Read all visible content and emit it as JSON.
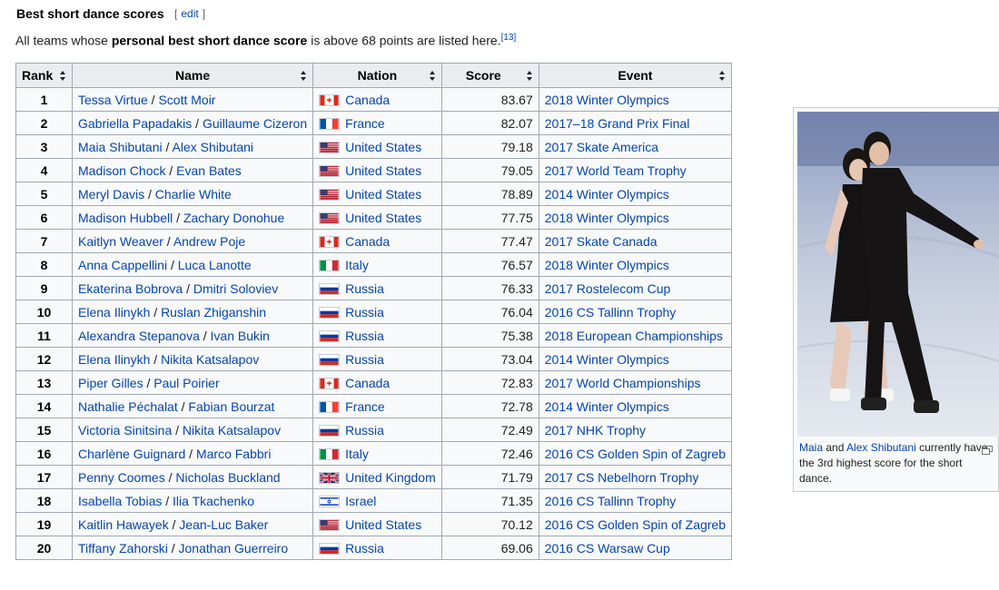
{
  "section": {
    "heading": "Best short dance scores",
    "edit_link": "edit",
    "intro_pre": "All teams whose ",
    "intro_bold": "personal best short dance score",
    "intro_post": " is above 68 points are listed here.",
    "ref": "[13]"
  },
  "table": {
    "headers": [
      "Rank",
      "Name",
      "Nation",
      "Score",
      "Event"
    ],
    "rows": [
      {
        "rank": "1",
        "p1": "Tessa Virtue",
        "p2": "Scott Moir",
        "nation": "Canada",
        "flag": "ca",
        "score": "83.67",
        "event": "2018 Winter Olympics"
      },
      {
        "rank": "2",
        "p1": "Gabriella Papadakis",
        "p2": "Guillaume Cizeron",
        "nation": "France",
        "flag": "fr",
        "score": "82.07",
        "event": "2017–18 Grand Prix Final"
      },
      {
        "rank": "3",
        "p1": "Maia Shibutani",
        "p2": "Alex Shibutani",
        "nation": "United States",
        "flag": "us",
        "score": "79.18",
        "event": "2017 Skate America"
      },
      {
        "rank": "4",
        "p1": "Madison Chock",
        "p2": "Evan Bates",
        "nation": "United States",
        "flag": "us",
        "score": "79.05",
        "event": "2017 World Team Trophy"
      },
      {
        "rank": "5",
        "p1": "Meryl Davis",
        "p2": "Charlie White",
        "nation": "United States",
        "flag": "us",
        "score": "78.89",
        "event": "2014 Winter Olympics"
      },
      {
        "rank": "6",
        "p1": "Madison Hubbell",
        "p2": "Zachary Donohue",
        "nation": "United States",
        "flag": "us",
        "score": "77.75",
        "event": "2018 Winter Olympics"
      },
      {
        "rank": "7",
        "p1": "Kaitlyn Weaver",
        "p2": "Andrew Poje",
        "nation": "Canada",
        "flag": "ca",
        "score": "77.47",
        "event": "2017 Skate Canada"
      },
      {
        "rank": "8",
        "p1": "Anna Cappellini",
        "p2": "Luca Lanotte",
        "nation": "Italy",
        "flag": "it",
        "score": "76.57",
        "event": "2018 Winter Olympics"
      },
      {
        "rank": "9",
        "p1": "Ekaterina Bobrova",
        "p2": "Dmitri Soloviev",
        "nation": "Russia",
        "flag": "ru",
        "score": "76.33",
        "event": "2017 Rostelecom Cup"
      },
      {
        "rank": "10",
        "p1": "Elena Ilinykh",
        "p2": "Ruslan Zhiganshin",
        "nation": "Russia",
        "flag": "ru",
        "score": "76.04",
        "event": "2016 CS Tallinn Trophy"
      },
      {
        "rank": "11",
        "p1": "Alexandra Stepanova",
        "p2": "Ivan Bukin",
        "nation": "Russia",
        "flag": "ru",
        "score": "75.38",
        "event": "2018 European Championships"
      },
      {
        "rank": "12",
        "p1": "Elena Ilinykh",
        "p2": "Nikita Katsalapov",
        "nation": "Russia",
        "flag": "ru",
        "score": "73.04",
        "event": "2014 Winter Olympics"
      },
      {
        "rank": "13",
        "p1": "Piper Gilles",
        "p2": "Paul Poirier",
        "nation": "Canada",
        "flag": "ca",
        "score": "72.83",
        "event": "2017 World Championships"
      },
      {
        "rank": "14",
        "p1": "Nathalie Péchalat",
        "p2": "Fabian Bourzat",
        "nation": "France",
        "flag": "fr",
        "score": "72.78",
        "event": "2014 Winter Olympics"
      },
      {
        "rank": "15",
        "p1": "Victoria Sinitsina",
        "p2": "Nikita Katsalapov",
        "nation": "Russia",
        "flag": "ru",
        "score": "72.49",
        "event": "2017 NHK Trophy"
      },
      {
        "rank": "16",
        "p1": "Charlène Guignard",
        "p2": "Marco Fabbri",
        "nation": "Italy",
        "flag": "it",
        "score": "72.46",
        "event": "2016 CS Golden Spin of Zagreb"
      },
      {
        "rank": "17",
        "p1": "Penny Coomes",
        "p2": "Nicholas Buckland",
        "nation": "United Kingdom",
        "flag": "uk",
        "score": "71.79",
        "event": "2017 CS Nebelhorn Trophy"
      },
      {
        "rank": "18",
        "p1": "Isabella Tobias",
        "p2": "Ilia Tkachenko",
        "nation": "Israel",
        "flag": "il",
        "score": "71.35",
        "event": "2016 CS Tallinn Trophy"
      },
      {
        "rank": "19",
        "p1": "Kaitlin Hawayek",
        "p2": "Jean-Luc Baker",
        "nation": "United States",
        "flag": "us",
        "score": "70.12",
        "event": "2016 CS Golden Spin of Zagreb"
      },
      {
        "rank": "20",
        "p1": "Tiffany Zahorski",
        "p2": "Jonathan Guerreiro",
        "nation": "Russia",
        "flag": "ru",
        "score": "69.06",
        "event": "2016 CS Warsaw Cup"
      }
    ]
  },
  "thumb": {
    "caption_link1": "Maia",
    "caption_and": " and ",
    "caption_link2": "Alex Shibutani",
    "caption_rest": " currently have the 3rd highest score for the short dance.",
    "enlarge_icon": "enlarge-icon"
  }
}
